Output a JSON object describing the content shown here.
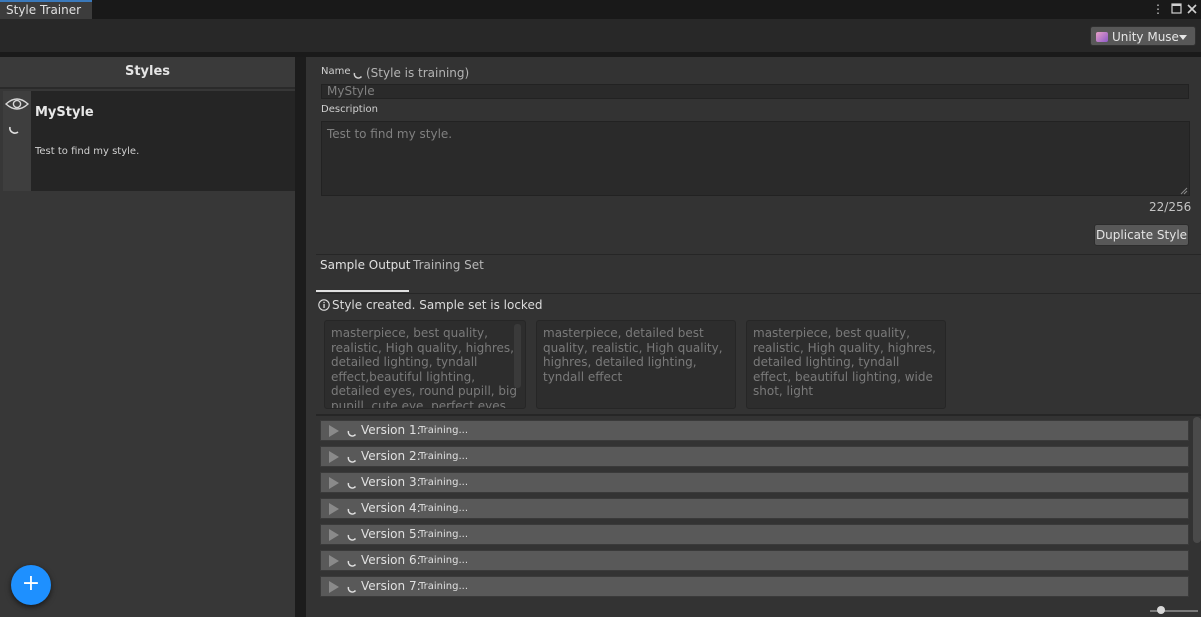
{
  "window": {
    "tab_title": "Style Trainer",
    "menu_icon": "kebab-menu-icon",
    "maximize_icon": "maximize-icon",
    "close_icon": "close-icon"
  },
  "toolbar": {
    "muse_label": "Unity Muse"
  },
  "styles_panel": {
    "header": "Styles",
    "items": [
      {
        "name": "MyStyle",
        "description": "Test to find my style."
      }
    ],
    "add_label": "+"
  },
  "details": {
    "name_label": "Name",
    "name_status": "(Style is training)",
    "name_value": "MyStyle",
    "description_label": "Description",
    "description_value": "Test to find my style.",
    "char_count": "22/256",
    "duplicate_label": "Duplicate Style"
  },
  "tabs": [
    {
      "label": "Sample Output",
      "selected": true
    },
    {
      "label": "Training Set",
      "selected": false
    }
  ],
  "info_message": "Style created. Sample set is locked",
  "prompts": [
    "masterpiece, best quality, realistic, High quality, highres, detailed lighting, tyndall effect,beautiful lighting, detailed eyes, round pupill, big pupill, cute eye, perfect eyes",
    "masterpiece, detailed best quality, realistic, High quality, highres, detailed lighting, tyndall effect",
    "masterpiece, best quality, realistic, High quality, highres, detailed lighting, tyndall effect, beautiful lighting, wide shot, light"
  ],
  "versions": [
    {
      "label": "Version 1:",
      "status": "Training..."
    },
    {
      "label": "Version 2:",
      "status": "Training..."
    },
    {
      "label": "Version 3:",
      "status": "Training..."
    },
    {
      "label": "Version 4:",
      "status": "Training..."
    },
    {
      "label": "Version 5:",
      "status": "Training..."
    },
    {
      "label": "Version 6:",
      "status": "Training..."
    },
    {
      "label": "Version 7:",
      "status": "Training..."
    }
  ],
  "colors": {
    "accent": "#1e90ff",
    "tab_accent": "#3a79bb"
  }
}
